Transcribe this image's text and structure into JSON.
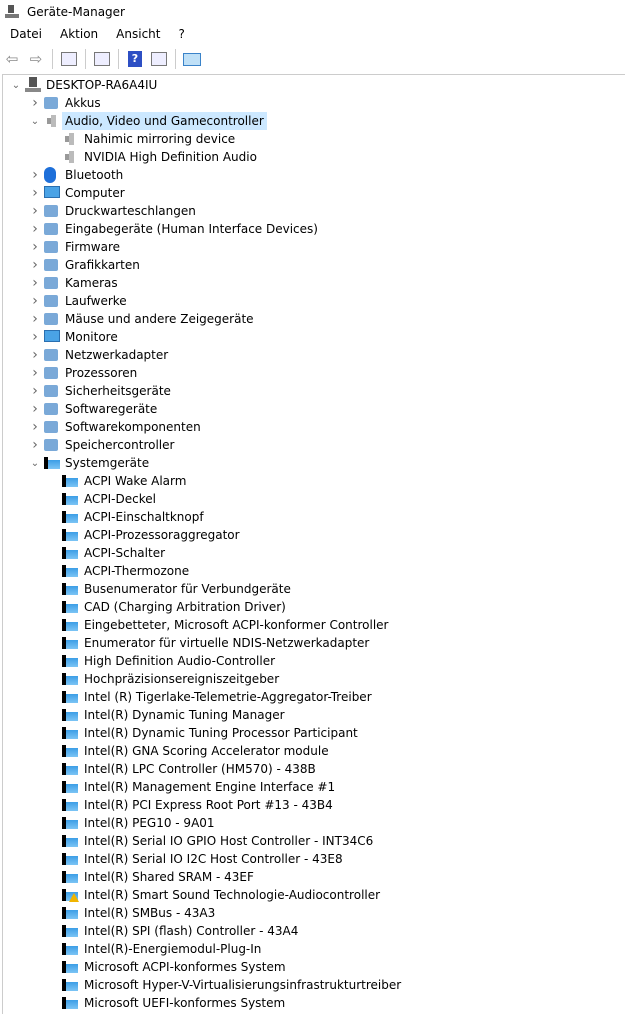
{
  "window": {
    "title": "Geräte-Manager"
  },
  "menu": [
    "Datei",
    "Aktion",
    "Ansicht",
    "?"
  ],
  "toolbar": [
    {
      "icon": "back-icon"
    },
    {
      "icon": "forward-icon"
    },
    {
      "icon": "show-hide-console-tree-icon"
    },
    {
      "icon": "properties-icon"
    },
    {
      "icon": "help-icon"
    },
    {
      "icon": "run-icon"
    },
    {
      "icon": "scan-hardware-icon"
    }
  ],
  "tree": [
    {
      "level": 0,
      "label": "DESKTOP-RA6A4IU",
      "expanded": true,
      "icon": "computer-host"
    },
    {
      "level": 1,
      "label": "Akkus",
      "expanded": false,
      "icon": "battery"
    },
    {
      "level": 1,
      "label": "Audio, Video und Gamecontroller",
      "expanded": true,
      "icon": "speaker",
      "selected": true
    },
    {
      "level": 2,
      "label": "Nahimic mirroring device",
      "icon": "speaker"
    },
    {
      "level": 2,
      "label": "NVIDIA High Definition Audio",
      "icon": "speaker"
    },
    {
      "level": 1,
      "label": "Bluetooth",
      "expanded": false,
      "icon": "bluetooth"
    },
    {
      "level": 1,
      "label": "Computer",
      "expanded": false,
      "icon": "monitor"
    },
    {
      "level": 1,
      "label": "Druckwarteschlangen",
      "expanded": false,
      "icon": "printer"
    },
    {
      "level": 1,
      "label": "Eingabegeräte (Human Interface Devices)",
      "expanded": false,
      "icon": "hid"
    },
    {
      "level": 1,
      "label": "Firmware",
      "expanded": false,
      "icon": "chip"
    },
    {
      "level": 1,
      "label": "Grafikkarten",
      "expanded": false,
      "icon": "display-adapter"
    },
    {
      "level": 1,
      "label": "Kameras",
      "expanded": false,
      "icon": "camera"
    },
    {
      "level": 1,
      "label": "Laufwerke",
      "expanded": false,
      "icon": "drive"
    },
    {
      "level": 1,
      "label": "Mäuse und andere Zeigegeräte",
      "expanded": false,
      "icon": "mouse"
    },
    {
      "level": 1,
      "label": "Monitore",
      "expanded": false,
      "icon": "monitor"
    },
    {
      "level": 1,
      "label": "Netzwerkadapter",
      "expanded": false,
      "icon": "network"
    },
    {
      "level": 1,
      "label": "Prozessoren",
      "expanded": false,
      "icon": "processor"
    },
    {
      "level": 1,
      "label": "Sicherheitsgeräte",
      "expanded": false,
      "icon": "security"
    },
    {
      "level": 1,
      "label": "Softwaregeräte",
      "expanded": false,
      "icon": "software-device"
    },
    {
      "level": 1,
      "label": "Softwarekomponenten",
      "expanded": false,
      "icon": "software-component"
    },
    {
      "level": 1,
      "label": "Speichercontroller",
      "expanded": false,
      "icon": "storage-controller"
    },
    {
      "level": 1,
      "label": "Systemgeräte",
      "expanded": true,
      "icon": "system"
    },
    {
      "level": 2,
      "label": "ACPI Wake Alarm",
      "icon": "system"
    },
    {
      "level": 2,
      "label": "ACPI-Deckel",
      "icon": "system"
    },
    {
      "level": 2,
      "label": "ACPI-Einschaltknopf",
      "icon": "system"
    },
    {
      "level": 2,
      "label": "ACPI-Prozessoraggregator",
      "icon": "system"
    },
    {
      "level": 2,
      "label": "ACPI-Schalter",
      "icon": "system"
    },
    {
      "level": 2,
      "label": "ACPI-Thermozone",
      "icon": "system"
    },
    {
      "level": 2,
      "label": "Busenumerator für Verbundgeräte",
      "icon": "system"
    },
    {
      "level": 2,
      "label": "CAD (Charging Arbitration Driver)",
      "icon": "system"
    },
    {
      "level": 2,
      "label": "Eingebetteter, Microsoft ACPI-konformer Controller",
      "icon": "system"
    },
    {
      "level": 2,
      "label": "Enumerator für virtuelle NDIS-Netzwerkadapter",
      "icon": "system"
    },
    {
      "level": 2,
      "label": "High Definition Audio-Controller",
      "icon": "system"
    },
    {
      "level": 2,
      "label": "Hochpräzisionsereigniszeitgeber",
      "icon": "system"
    },
    {
      "level": 2,
      "label": "Intel (R) Tigerlake-Telemetrie-Aggregator-Treiber",
      "icon": "system"
    },
    {
      "level": 2,
      "label": "Intel(R) Dynamic Tuning Manager",
      "icon": "system"
    },
    {
      "level": 2,
      "label": "Intel(R) Dynamic Tuning Processor Participant",
      "icon": "system"
    },
    {
      "level": 2,
      "label": "Intel(R) GNA Scoring Accelerator module",
      "icon": "system"
    },
    {
      "level": 2,
      "label": "Intel(R) LPC Controller (HM570) - 438B",
      "icon": "system"
    },
    {
      "level": 2,
      "label": "Intel(R) Management Engine Interface #1",
      "icon": "system"
    },
    {
      "level": 2,
      "label": "Intel(R) PCI Express Root Port #13 - 43B4",
      "icon": "system"
    },
    {
      "level": 2,
      "label": "Intel(R) PEG10 - 9A01",
      "icon": "system"
    },
    {
      "level": 2,
      "label": "Intel(R) Serial IO GPIO Host Controller - INT34C6",
      "icon": "system"
    },
    {
      "level": 2,
      "label": "Intel(R) Serial IO I2C Host Controller - 43E8",
      "icon": "system"
    },
    {
      "level": 2,
      "label": "Intel(R) Shared SRAM - 43EF",
      "icon": "system"
    },
    {
      "level": 2,
      "label": "Intel(R) Smart Sound Technologie-Audiocontroller",
      "icon": "system",
      "warning": true
    },
    {
      "level": 2,
      "label": "Intel(R) SMBus - 43A3",
      "icon": "system"
    },
    {
      "level": 2,
      "label": "Intel(R) SPI (flash) Controller - 43A4",
      "icon": "system"
    },
    {
      "level": 2,
      "label": "Intel(R)-Energiemodul-Plug-In",
      "icon": "system"
    },
    {
      "level": 2,
      "label": "Microsoft ACPI-konformes System",
      "icon": "system"
    },
    {
      "level": 2,
      "label": "Microsoft Hyper-V-Virtualisierungsinfrastrukturtreiber",
      "icon": "system"
    },
    {
      "level": 2,
      "label": "Microsoft UEFI-konformes System",
      "icon": "system"
    }
  ]
}
